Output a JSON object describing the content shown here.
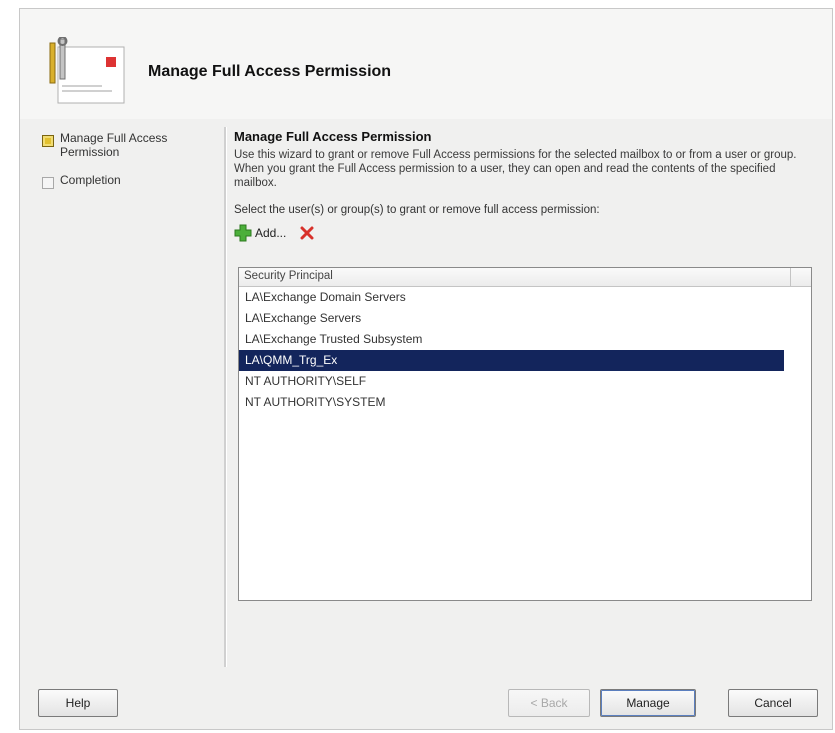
{
  "header": {
    "title": "Manage Full Access Permission"
  },
  "nav": {
    "items": [
      {
        "label": "Manage Full Access Permission",
        "state": "current"
      },
      {
        "label": "Completion",
        "state": "pending"
      }
    ]
  },
  "content": {
    "heading": "Manage Full Access Permission",
    "description": "Use this wizard to grant or remove Full Access permissions for the selected mailbox to or from a user or group. When you grant the Full Access permission to a user, they can open and read the contents of the specified mailbox.",
    "select_label": "Select the user(s) or group(s) to grant or remove full access permission:",
    "add_label": "Add...",
    "add_icon": "plus-icon",
    "remove_icon": "remove-x-icon"
  },
  "list": {
    "column_header": "Security Principal",
    "rows": [
      "LA\\Exchange Domain Servers",
      "LA\\Exchange Servers",
      "LA\\Exchange Trusted Subsystem",
      "LA\\QMM_Trg_Ex",
      "NT AUTHORITY\\SELF",
      "NT AUTHORITY\\SYSTEM"
    ],
    "selected_index": 3
  },
  "buttons": {
    "help": "Help",
    "back": "< Back",
    "manage": "Manage",
    "cancel": "Cancel"
  },
  "colors": {
    "selection": "#13255c",
    "current_step": "#e2c02e"
  }
}
